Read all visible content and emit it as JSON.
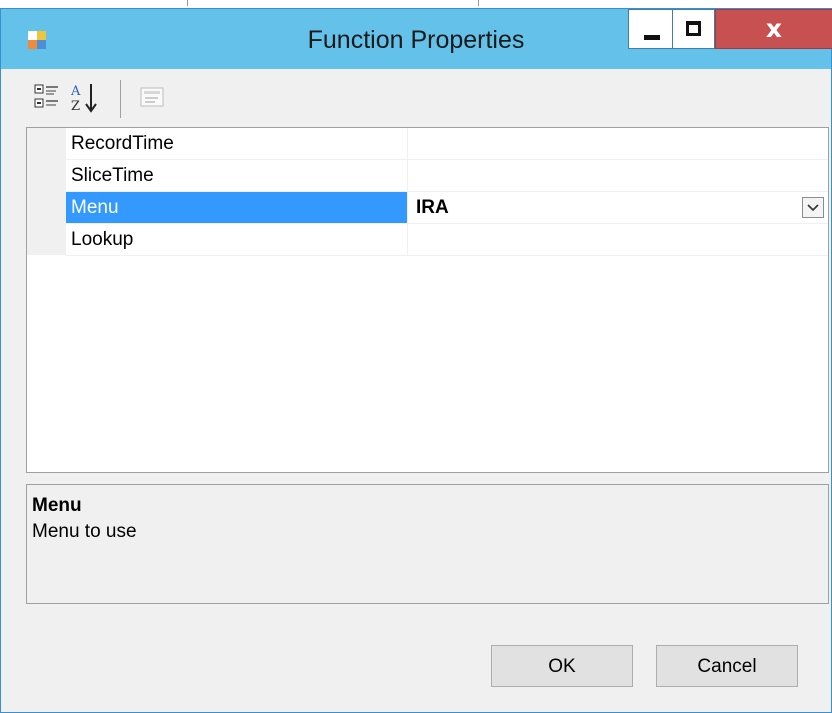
{
  "window": {
    "title": "Function Properties",
    "close_glyph": "x"
  },
  "toolbar": {
    "icons": [
      "categorized-icon",
      "alphabetical-sort-icon",
      "property-pages-icon"
    ]
  },
  "grid": {
    "rows": [
      {
        "name": "RecordTime",
        "value": ""
      },
      {
        "name": "SliceTime",
        "value": ""
      },
      {
        "name": "Menu",
        "value": "IRA",
        "selected": true
      },
      {
        "name": "Lookup",
        "value": ""
      }
    ]
  },
  "description": {
    "title": "Menu",
    "text": "Menu to use"
  },
  "buttons": {
    "ok": "OK",
    "cancel": "Cancel"
  },
  "colors": {
    "titlebar": "#63c1ea",
    "selection": "#3399ff",
    "close": "#c75050"
  }
}
